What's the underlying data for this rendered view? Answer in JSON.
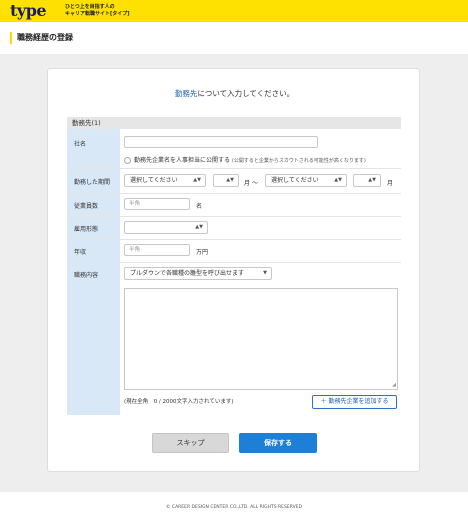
{
  "header": {
    "logo": "type",
    "tagline_line1": "ひとつ上を目指す人の",
    "tagline_line2": "キャリア転職サイト[タイプ]"
  },
  "page": {
    "title": "職務経歴の登録"
  },
  "intro": {
    "link_text": "勤務先",
    "rest_text": "について入力してください。"
  },
  "section": {
    "heading": "勤務先(1)"
  },
  "fields": {
    "company": {
      "label": "社名",
      "value": "",
      "publish_label": "勤務先企業名を人事担当に公開する",
      "publish_note": "(公開すると企業からスカウトされる可能性が高くなります)"
    },
    "period": {
      "label": "勤務した期間",
      "start_year": "選択してください",
      "start_month": "",
      "month_suffix": "月",
      "separator": "〜",
      "end_year": "選択してください",
      "end_month": "",
      "end_month_suffix": "月"
    },
    "employees": {
      "label": "従業員数",
      "placeholder": "半角",
      "suffix": "名"
    },
    "employment_type": {
      "label": "雇用形態",
      "value": ""
    },
    "salary": {
      "label": "年収",
      "placeholder": "半角",
      "suffix": "万円"
    },
    "duties": {
      "label": "職務内容",
      "template_select": "プルダウンで各職種の雛型を呼び出せます",
      "text": "",
      "counter": "(現在全角　0 / 2000文字入力されています)"
    }
  },
  "buttons": {
    "add_company": "＋ 勤務先企業を追加する",
    "skip": "スキップ",
    "save": "保存する"
  },
  "footer": {
    "copyright": "© CAREER DESIGN CENTER CO.,LTD. ALL RIGHTS RESERVED"
  },
  "colors": {
    "brand_yellow": "#ffe100",
    "primary_blue": "#1e7fd6",
    "label_bg": "#d9e8f7"
  }
}
